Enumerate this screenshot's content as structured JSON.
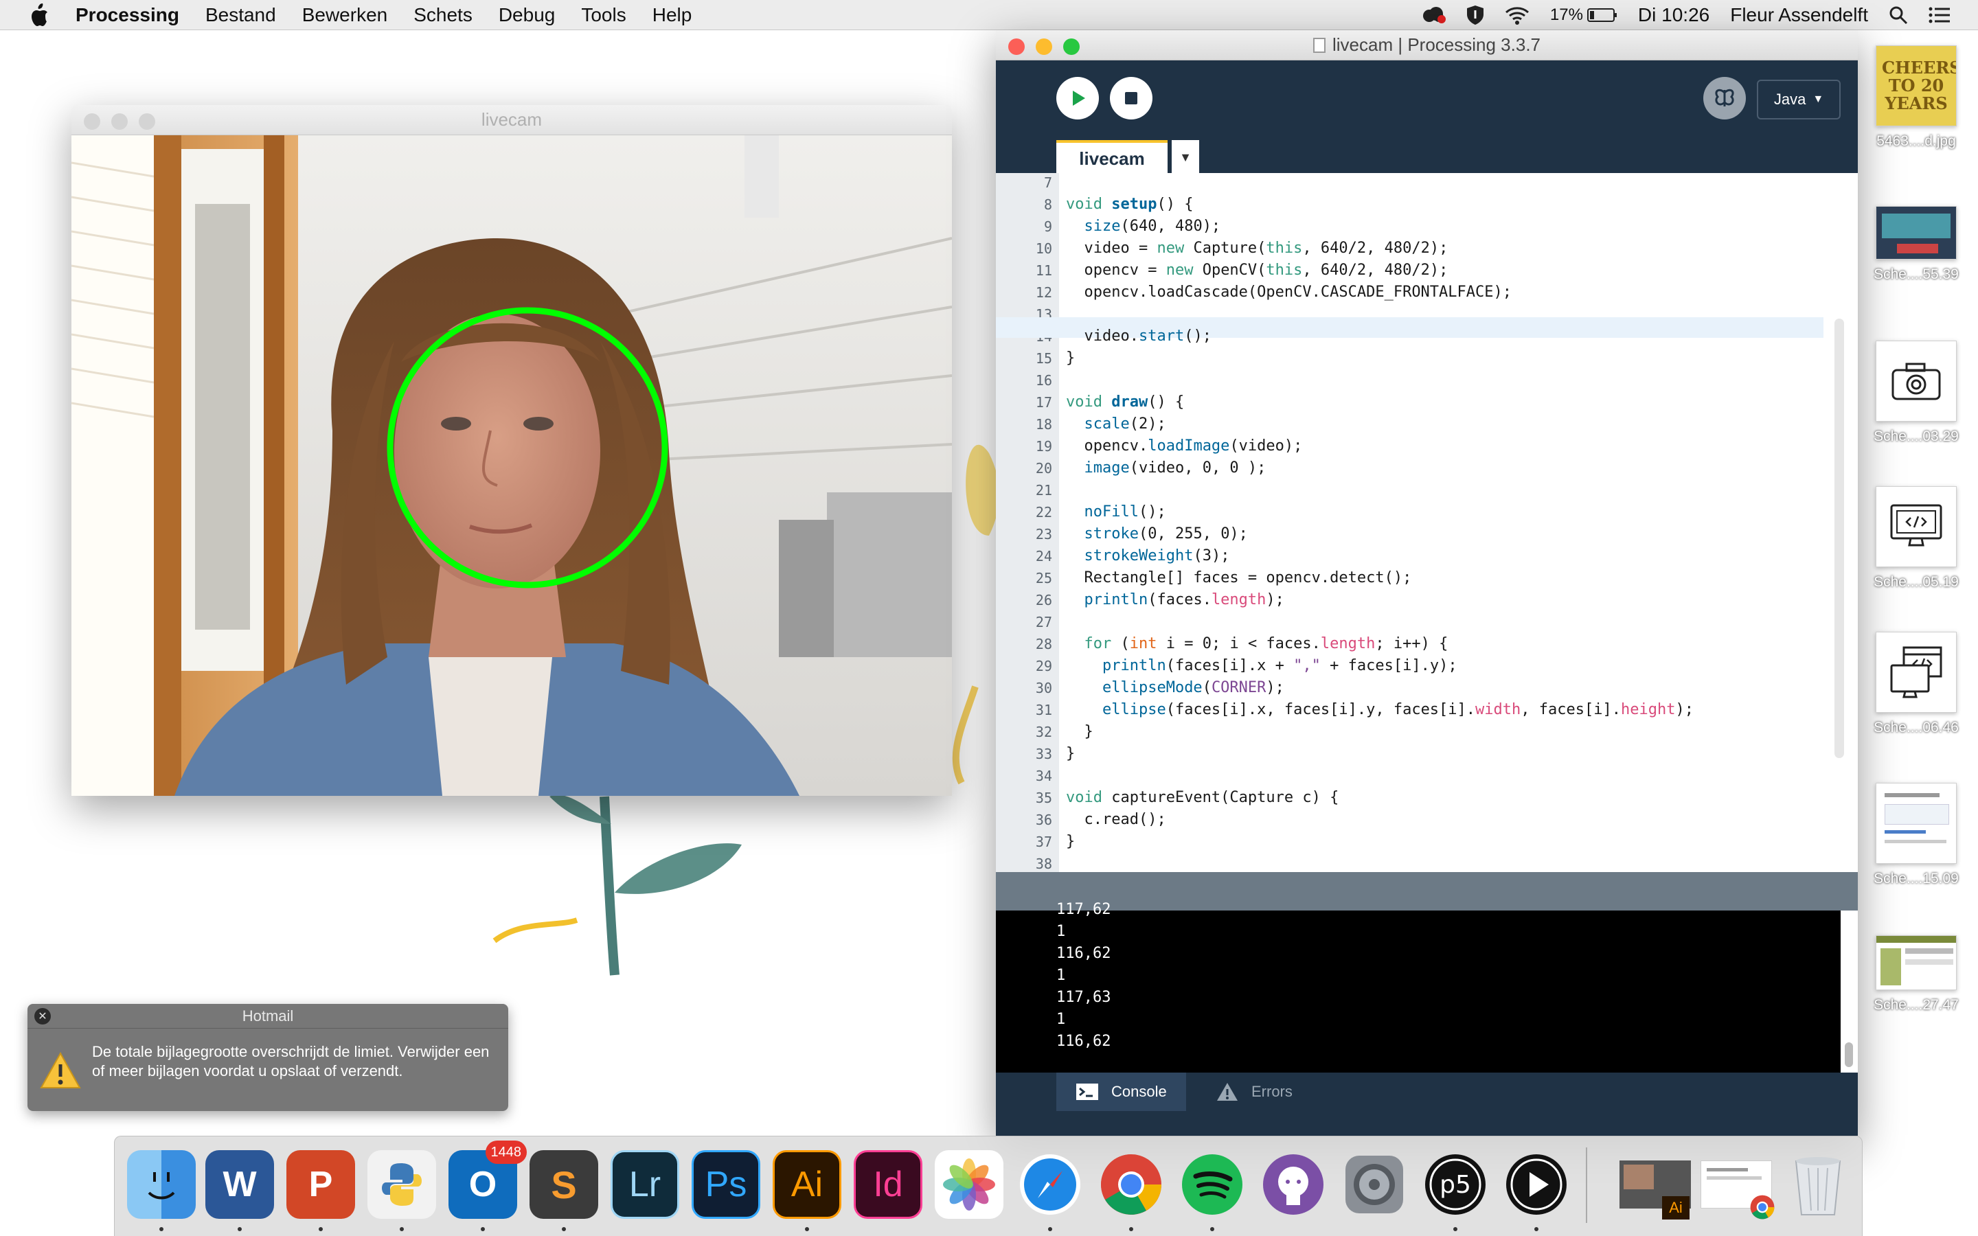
{
  "menubar": {
    "app_name": "Processing",
    "items": [
      "Bestand",
      "Bewerken",
      "Schets",
      "Debug",
      "Tools",
      "Help"
    ],
    "battery": "17%",
    "clock": "Di 10:26",
    "user": "Fleur Assendelft"
  },
  "livecam_window": {
    "title": "livecam"
  },
  "pde_window": {
    "title": "livecam | Processing 3.3.7",
    "mode": "Java",
    "tab": "livecam",
    "code_lines": [
      {
        "n": "7",
        "html": ""
      },
      {
        "n": "8",
        "html": "<span class='kw'>void</span> <span class='kb'>setup</span>() {"
      },
      {
        "n": "9",
        "html": "  <span class='fn'>size</span>(640, 480);"
      },
      {
        "n": "10",
        "html": "  video = <span class='kw'>new</span> Capture(<span class='kw'>this</span>, 640/2, 480/2);"
      },
      {
        "n": "11",
        "html": "  opencv = <span class='kw'>new</span> OpenCV(<span class='kw'>this</span>, 640/2, 480/2);"
      },
      {
        "n": "12",
        "html": "  opencv.loadCascade(OpenCV.CASCADE_FRONTALFACE);"
      },
      {
        "n": "13",
        "html": ""
      },
      {
        "n": "14",
        "html": "  video.<span class='fn'>start</span>();"
      },
      {
        "n": "15",
        "html": "}"
      },
      {
        "n": "16",
        "html": ""
      },
      {
        "n": "17",
        "html": "<span class='kw'>void</span> <span class='kb'>draw</span>() {"
      },
      {
        "n": "18",
        "html": "  <span class='fn'>scale</span>(2);"
      },
      {
        "n": "19",
        "html": "  opencv.<span class='fn'>loadImage</span>(video);"
      },
      {
        "n": "20",
        "html": "  <span class='fn'>image</span>(video, 0, 0 );"
      },
      {
        "n": "21",
        "html": ""
      },
      {
        "n": "22",
        "html": "  <span class='fn'>noFill</span>();"
      },
      {
        "n": "23",
        "html": "  <span class='fn'>stroke</span>(0, 255, 0);"
      },
      {
        "n": "24",
        "html": "  <span class='fn'>strokeWeight</span>(3);"
      },
      {
        "n": "25",
        "html": "  Rectangle[] faces = opencv.detect();"
      },
      {
        "n": "26",
        "html": "  <span class='fn'>println</span>(faces.<span class='pr'>length</span>);"
      },
      {
        "n": "27",
        "html": ""
      },
      {
        "n": "28",
        "html": "  <span class='kw'>for</span> (<span class='ty'>int</span> i = 0; i &lt; faces.<span class='pr'>length</span>; i++) {"
      },
      {
        "n": "29",
        "html": "    <span class='fn'>println</span>(faces[i].x + <span class='st'>\",\"</span> + faces[i].y);"
      },
      {
        "n": "30",
        "html": "    <span class='fn'>ellipseMode</span>(<span class='st'>CORNER</span>);"
      },
      {
        "n": "31",
        "html": "    <span class='fn'>ellipse</span>(faces[i].x, faces[i].y, faces[i].<span class='pr'>width</span>, faces[i].<span class='pr'>height</span>);"
      },
      {
        "n": "32",
        "html": "  }"
      },
      {
        "n": "33",
        "html": "}"
      },
      {
        "n": "34",
        "html": ""
      },
      {
        "n": "35",
        "html": "<span class='kw'>void</span> captureEvent(Capture c) {"
      },
      {
        "n": "36",
        "html": "  c.read();"
      },
      {
        "n": "37",
        "html": "}"
      },
      {
        "n": "38",
        "html": ""
      }
    ],
    "console_lines": [
      "117,62",
      "1",
      "116,62",
      "1",
      "117,63",
      "1",
      "116,62"
    ],
    "footer_tabs": [
      "Console",
      "Errors"
    ]
  },
  "desktop_files": [
    {
      "label": "5463....d.jpg",
      "kind": "photo"
    },
    {
      "label": "Sche....55.39",
      "kind": "screenshot-video"
    },
    {
      "label": "Sche....03.29",
      "kind": "camera"
    },
    {
      "label": "Sche....05.19",
      "kind": "monitor-code"
    },
    {
      "label": "Sche....06.46",
      "kind": "code-window"
    },
    {
      "label": "Sche....15.09",
      "kind": "document"
    },
    {
      "label": "Sche....27.47",
      "kind": "webpage"
    }
  ],
  "desktop_image_text": "CHEERS TO 20 YEARS",
  "notification": {
    "app": "Hotmail",
    "message": "De totale bijlagegrootte overschrijdt de limiet. Verwijder een of meer bijlagen voordat u opslaat of verzendt."
  },
  "dock": {
    "outlook_badge": "1448",
    "apps": [
      "Finder",
      "Word",
      "PowerPoint",
      "Python",
      "Outlook",
      "Sublime Text",
      "Lightroom",
      "Photoshop",
      "Illustrator",
      "InDesign",
      "Photos",
      "Safari",
      "Chrome",
      "Spotify",
      "GitHub",
      "System Preferences",
      "p5",
      "Quick Player",
      "Window preview",
      "Document preview",
      "Trash"
    ],
    "labels": {
      "lr": "Lr",
      "ps": "Ps",
      "ai": "Ai",
      "id": "Id",
      "w": "W",
      "p": "P",
      "o": "O",
      "s": "S",
      "p5": "p5"
    }
  },
  "colors": {
    "pde_bg": "#1f3245",
    "face_circle": "#00ff00",
    "tab_accent": "#f8c32c"
  }
}
